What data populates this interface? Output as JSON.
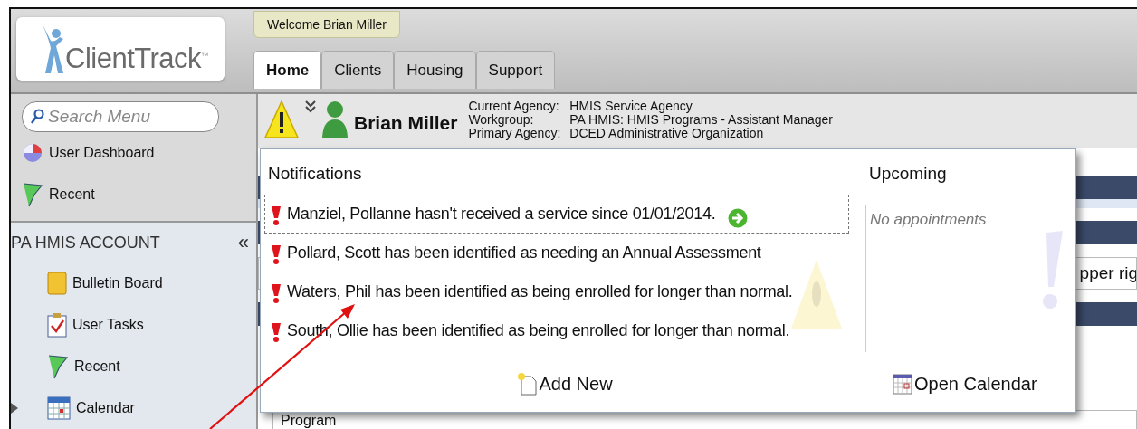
{
  "header": {
    "logo": "ClientTrack",
    "logo_mark": "™",
    "welcome": "Welcome Brian Miller",
    "tabs": [
      {
        "label": "Home",
        "selected": true
      },
      {
        "label": "Clients",
        "selected": false
      },
      {
        "label": "Housing",
        "selected": false
      },
      {
        "label": "Support",
        "selected": false
      }
    ]
  },
  "sidebar": {
    "search": {
      "placeholder": "Search Menu"
    },
    "top_items": [
      {
        "label": "User Dashboard",
        "kind": "dashboard"
      },
      {
        "label": "Recent",
        "kind": "flag"
      }
    ],
    "section": {
      "title": "PA HMIS ACCOUNT",
      "collapse": "«"
    },
    "items": [
      {
        "label": "Bulletin Board",
        "kind": "board"
      },
      {
        "label": "User Tasks",
        "kind": "tasks"
      },
      {
        "label": "Recent",
        "kind": "flag"
      },
      {
        "label": "Calendar",
        "kind": "calendar",
        "expanded": false
      }
    ]
  },
  "user_bar": {
    "name": "Brian Miller",
    "info": [
      {
        "label": "Current Agency:",
        "value": "HMIS Service Agency"
      },
      {
        "label": "Workgroup:",
        "value": "PA HMIS: HMIS Programs - Assistant Manager"
      },
      {
        "label": "Primary Agency:",
        "value": "DCED Administrative Organization"
      }
    ]
  },
  "background": {
    "right_text": "pper rig",
    "panel_label": "Program"
  },
  "popup": {
    "notifications": {
      "title": "Notifications",
      "items": [
        {
          "text": "Manziel, Pollanne hasn't received a service since 01/01/2014.",
          "selected": true
        },
        {
          "text": "Pollard, Scott has been identified as needing an Annual Assessment",
          "selected": false
        },
        {
          "text": "Waters, Phil has been identified as being enrolled for longer than normal.",
          "selected": false
        },
        {
          "text": "South, Ollie has been identified as being enrolled for longer than normal.",
          "selected": false
        }
      ],
      "action": "Add New"
    },
    "upcoming": {
      "title": "Upcoming",
      "empty": "No appointments",
      "action": "Open Calendar"
    }
  }
}
